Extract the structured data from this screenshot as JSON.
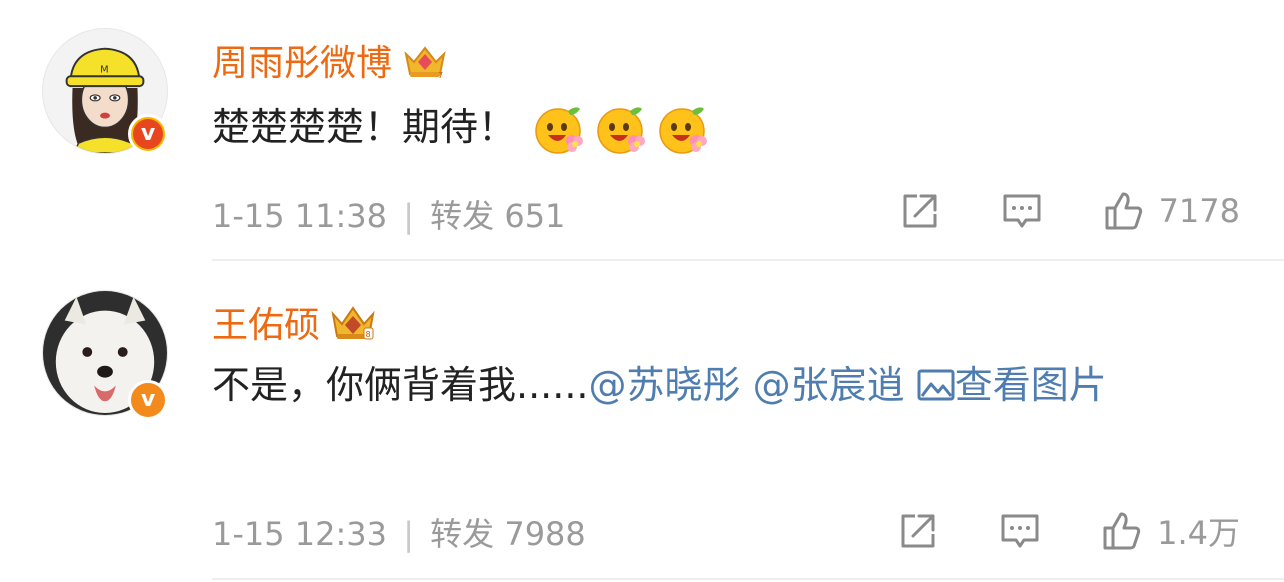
{
  "comments": [
    {
      "username": "周雨彤微博",
      "text": "楚楚楚楚！期待！",
      "emoji_icon": "smile-flower-emoji",
      "emoji_count": 3,
      "time": "1-15 11:38",
      "separator": "|",
      "repost_label": "转发",
      "repost_count": "651",
      "like_count": "7178",
      "verified_color": "#f6b800"
    },
    {
      "username": "王佑硕",
      "text_prefix": "不是，你俩背着我......",
      "mention1": "@苏晓彤",
      "mention2": "@张宸逍",
      "view_image_label": "查看图片",
      "time": "1-15 12:33",
      "separator": "|",
      "repost_label": "转发",
      "repost_count": "7988",
      "like_count": "1.4万",
      "verified_color": "#f28a1c"
    }
  ],
  "colors": {
    "username": "#ee6a12",
    "link": "#507daf",
    "meta": "#9a9a9a"
  }
}
